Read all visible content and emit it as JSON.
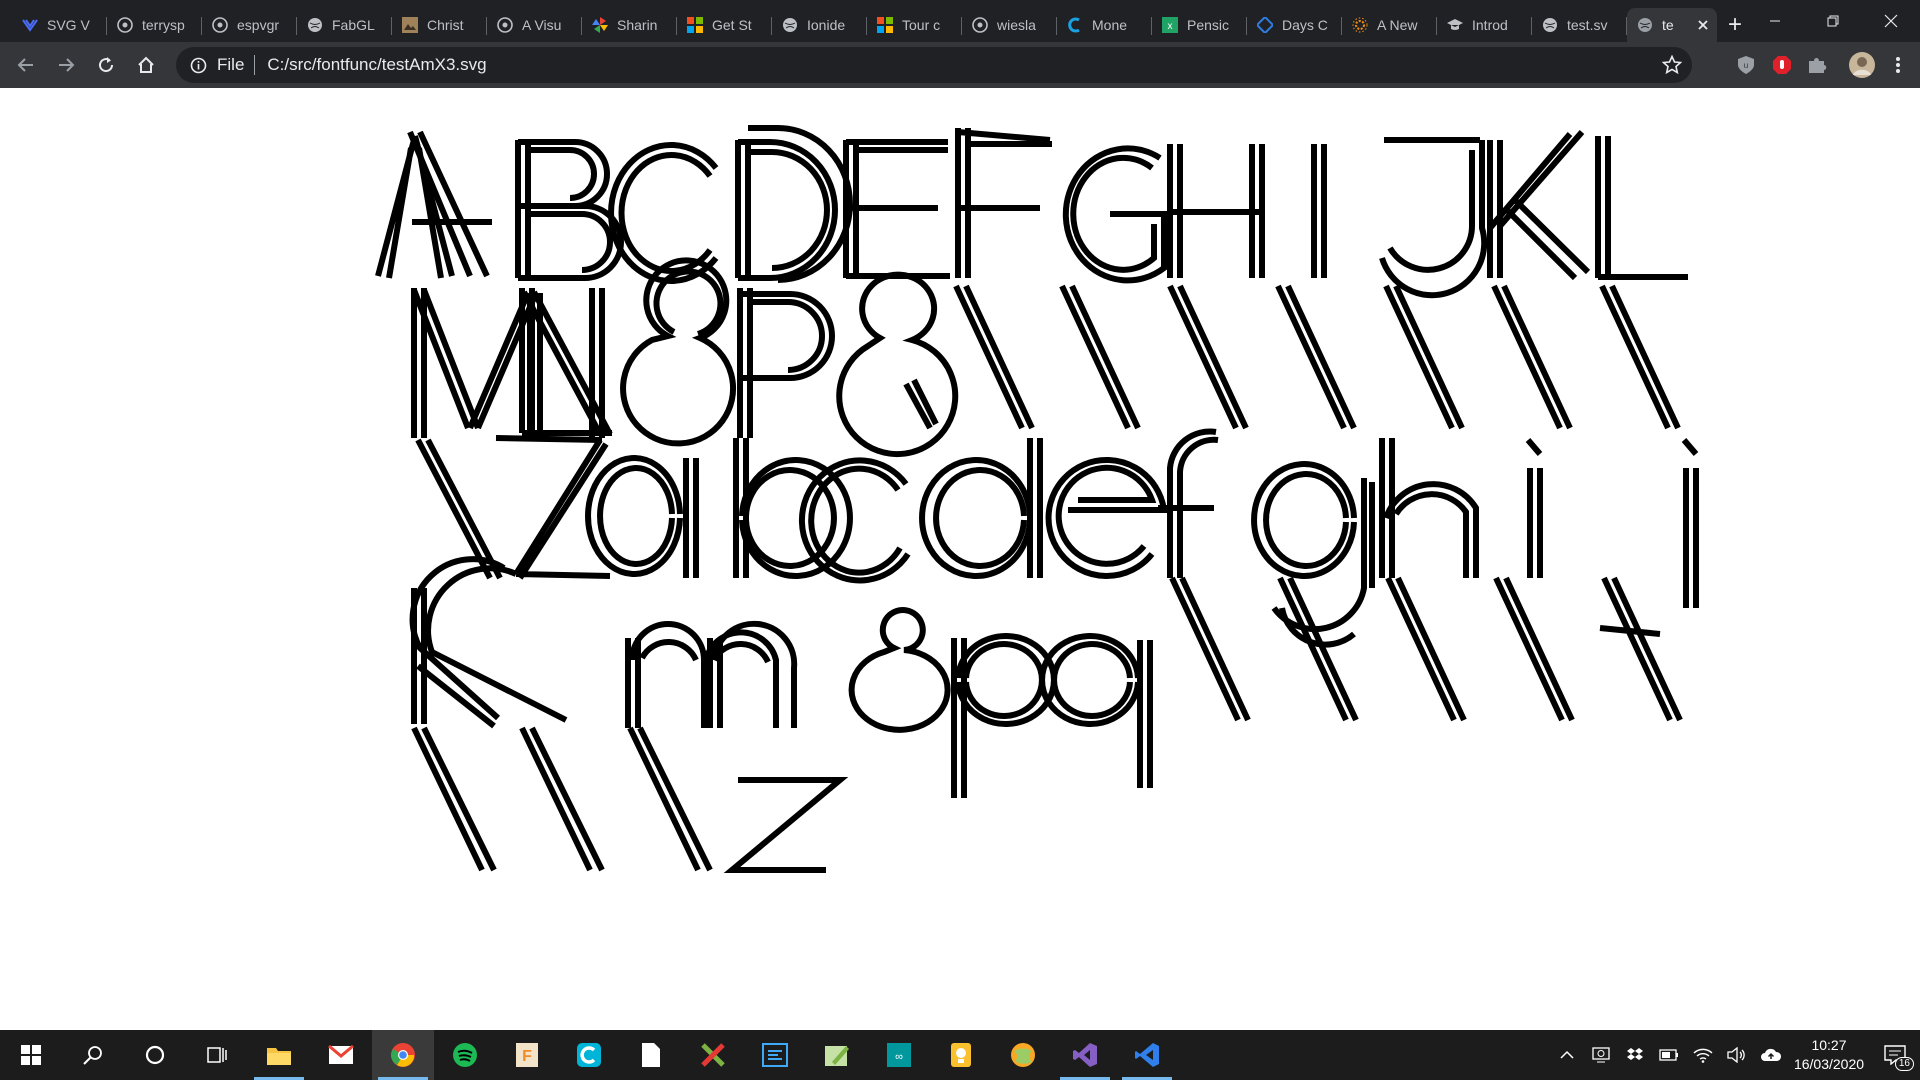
{
  "browser": {
    "tabs": [
      {
        "title": "SVG V",
        "icon": "svg-viewer-icon",
        "color": "#4a6cf7"
      },
      {
        "title": "terrysp",
        "icon": "github-icon",
        "color": "#bdc1c6"
      },
      {
        "title": "espvgr",
        "icon": "github-icon",
        "color": "#bdc1c6"
      },
      {
        "title": "FabGL",
        "icon": "globe-icon",
        "color": "#bdc1c6"
      },
      {
        "title": "Christ",
        "icon": "image-icon",
        "color": "#a0825a"
      },
      {
        "title": "A Visu",
        "icon": "github-icon",
        "color": "#bdc1c6"
      },
      {
        "title": "Sharin",
        "icon": "pinwheel-icon",
        "color": "#34a853"
      },
      {
        "title": "Get St",
        "icon": "microsoft-icon",
        "color": "#f25022"
      },
      {
        "title": "Ionide",
        "icon": "globe-icon",
        "color": "#bdc1c6"
      },
      {
        "title": "Tour c",
        "icon": "microsoft-icon",
        "color": "#f25022"
      },
      {
        "title": "wiesla",
        "icon": "github-icon",
        "color": "#bdc1c6"
      },
      {
        "title": "Mone",
        "icon": "money-icon",
        "color": "#1ba1e2"
      },
      {
        "title": "Pensic",
        "icon": "excel-icon",
        "color": "#21a366"
      },
      {
        "title": "Days C",
        "icon": "diamond-icon",
        "color": "#2f7de1"
      },
      {
        "title": "A New",
        "icon": "gear-icon",
        "color": "#f29111"
      },
      {
        "title": "Introd",
        "icon": "graduation-icon",
        "color": "#bdc1c6"
      },
      {
        "title": "test.sv",
        "icon": "globe-icon",
        "color": "#bdc1c6"
      },
      {
        "title": "te",
        "icon": "globe-icon",
        "color": "#9aa0a6",
        "active": true
      }
    ],
    "new_tab_label": "+",
    "address": {
      "scheme_label": "File",
      "url": "C:/src/fontfunc/testAmX3.svg"
    }
  },
  "content": {
    "title": "testAmX3.svg",
    "glyph_stroke": "#000000"
  },
  "taskbar": {
    "apps": [
      {
        "name": "file-explorer-icon",
        "color": "#f6c343",
        "running": true
      },
      {
        "name": "gmail-icon",
        "color": "#ea4335",
        "running": false
      },
      {
        "name": "chrome-icon",
        "color": "#4285f4",
        "running": true,
        "active": true
      },
      {
        "name": "spotify-icon",
        "color": "#1db954",
        "running": false
      },
      {
        "name": "fusion-icon",
        "color": "#f28c28",
        "running": false
      },
      {
        "name": "c-app-icon",
        "color": "#00b4d8",
        "running": false
      },
      {
        "name": "document-icon",
        "color": "#ffffff",
        "running": false
      },
      {
        "name": "xmind-icon",
        "color": "#e53935",
        "running": false
      },
      {
        "name": "terminal-app-icon",
        "color": "#3fa9f5",
        "running": false
      },
      {
        "name": "editor-app-icon",
        "color": "#7cb342",
        "running": false
      },
      {
        "name": "arduino-icon",
        "color": "#00979d",
        "running": false
      },
      {
        "name": "bulb-icon",
        "color": "#fbc02d",
        "running": false
      },
      {
        "name": "globe-app-icon",
        "color": "#9ccc65",
        "running": false
      },
      {
        "name": "visual-studio-icon",
        "color": "#865fc5",
        "running": true
      },
      {
        "name": "vscode-icon",
        "color": "#2f80ed",
        "running": true
      }
    ],
    "time": "10:27",
    "date": "16/03/2020",
    "notification_count": "16"
  }
}
